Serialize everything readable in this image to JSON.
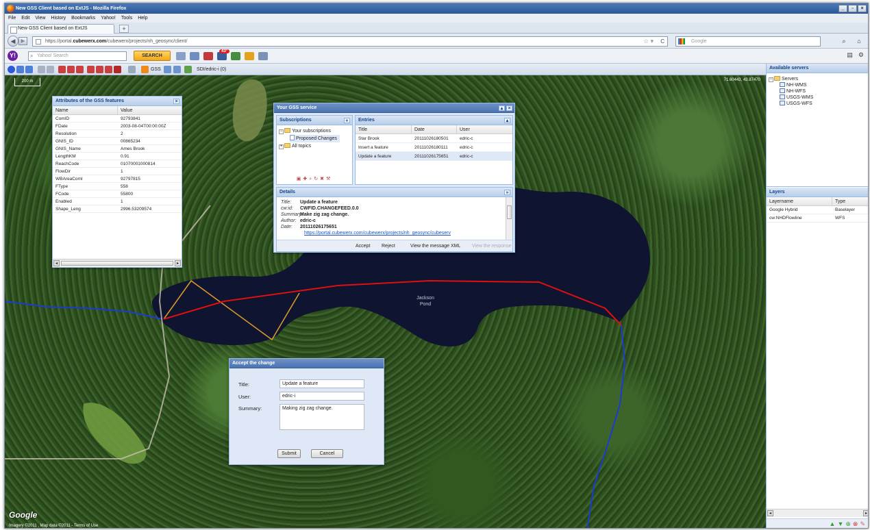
{
  "window": {
    "title": "New GSS Client based on ExtJS - Mozilla Firefox"
  },
  "menu": [
    "File",
    "Edit",
    "View",
    "History",
    "Bookmarks",
    "Yahoo!",
    "Tools",
    "Help"
  ],
  "tab": {
    "label": "New GSS Client based on ExtJS",
    "new_tab": "+"
  },
  "nav": {
    "url_prefix": "https://portal.",
    "url_domain": "cubewerx.com",
    "url_path": "/cubewerx/projects/nh_geosync/client/",
    "search_placeholder": "Google"
  },
  "yahoo": {
    "search_placeholder": "Yahoo! Search",
    "search_button": "SEARCH",
    "badge": "43°"
  },
  "toolbar": {
    "gss_label": "GSS",
    "user_label": "SDI/edric-i (0)"
  },
  "map": {
    "scale_label": "200 m",
    "coords": "71.60443, 43.87470",
    "lake_label_1": "Jackson",
    "lake_label_2": "Pond",
    "logo": "Google",
    "copyright": "Imagery ©2011 , Map data ©2011 - Terms of Use"
  },
  "attributes": {
    "title": "Attributes of the GSS features",
    "columns": [
      "Name",
      "Value"
    ],
    "rows": [
      [
        "ComID",
        "92793841"
      ],
      [
        "FDate",
        "2003-08-04T00:00:00Z"
      ],
      [
        "Resolution",
        "2"
      ],
      [
        "GNIS_ID",
        "00865234"
      ],
      [
        "GNIS_Name",
        "Ames Brook"
      ],
      [
        "LengthKM",
        "0.91"
      ],
      [
        "ReachCode",
        "01070001000814"
      ],
      [
        "FlowDir",
        "1"
      ],
      [
        "WBAreaComI",
        "92797815"
      ],
      [
        "FType",
        "558"
      ],
      [
        "FCode",
        "55800"
      ],
      [
        "Enabled",
        "1"
      ],
      [
        "Shape_Leng",
        "2996.53209574"
      ]
    ]
  },
  "gss": {
    "title": "Your GSS service",
    "subscriptions": {
      "title": "Subscriptions",
      "items": [
        "Your subscriptions",
        "Proposed Changes",
        "All topics"
      ]
    },
    "entries": {
      "title": "Entries",
      "columns": [
        "Title",
        "Date",
        "User"
      ],
      "rows": [
        [
          "Star Brook",
          "20111026180501",
          "edric-c"
        ],
        [
          "Insert a feature",
          "20111026180111",
          "edric-c"
        ],
        [
          "Update a feature",
          "20111026175651",
          "edric-c"
        ]
      ]
    },
    "details": {
      "title": "Details",
      "fields": [
        {
          "key": "Title:",
          "value": "Update a feature"
        },
        {
          "key": "cw:id:",
          "value": "CWFID.CHANGEFEED.0.0"
        },
        {
          "key": "Summary:",
          "value": "Make zig zag change."
        },
        {
          "key": "Author:",
          "value": "edric-c"
        },
        {
          "key": "Date:",
          "value": "20111026175651"
        }
      ],
      "link": "https://portal.cubewerx.com/cubewerx/projects/nh_geosync/cubeserv",
      "actions": [
        "Accept",
        "Reject",
        "View the message XML",
        "View the response"
      ]
    }
  },
  "accept_dialog": {
    "title": "Accept the change",
    "title_label": "Title:",
    "title_value": "Update a feature",
    "user_label": "User:",
    "user_value": "edric-i",
    "summary_label": "Summary:",
    "summary_value": "Making zig zag change.",
    "submit": "Submit",
    "cancel": "Cancel"
  },
  "servers": {
    "title": "Available servers",
    "root": "Servers",
    "items": [
      "NH-WMS",
      "NH-WFS",
      "USGS-WMS",
      "USGS-WFS"
    ]
  },
  "layers": {
    "title": "Layers",
    "columns": [
      "Layername",
      "Type"
    ],
    "rows": [
      [
        "Google Hybrid",
        "Baselayer"
      ],
      [
        "cw:NHDFlowline",
        "WFS"
      ]
    ]
  },
  "colors": {
    "ext_header": "#15428b",
    "panel_border": "#99bbe8",
    "flowline_red": "#e01010",
    "zigzag_orange": "#d99a2b",
    "stream_blue": "#1b3ccf",
    "lake": "#0f1430"
  }
}
